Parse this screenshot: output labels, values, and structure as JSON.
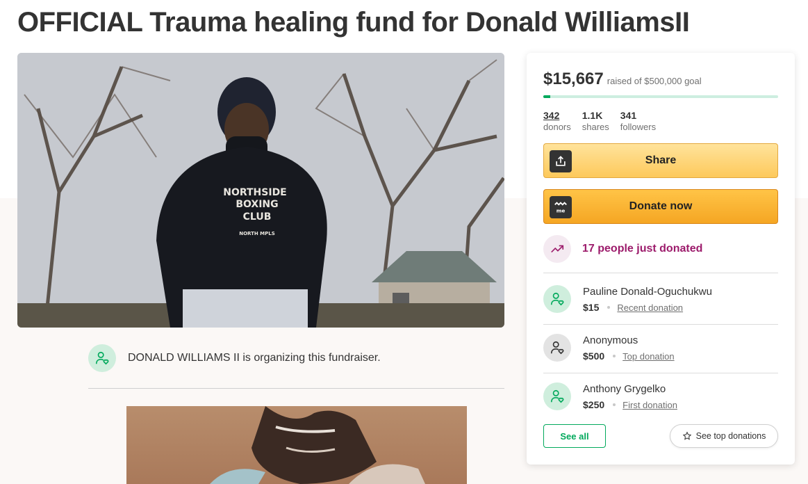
{
  "campaign": {
    "title": "OFFICIAL Trauma healing fund for Donald WilliamsII",
    "organizer_text": "DONALD WILLIAMS II is organizing this fundraiser.",
    "hero_image": "man-in-northside-boxing-club-hoodie-photo",
    "hoodie_text": [
      "NORTHSIDE",
      "BOXING",
      "CLUB",
      "NORTH MPLS"
    ]
  },
  "progress": {
    "raised": "$15,667",
    "goal_text": "raised of $500,000 goal",
    "fraction": 0.031
  },
  "stats": [
    {
      "value": "342",
      "label": "donors"
    },
    {
      "value": "1.1K",
      "label": "shares"
    },
    {
      "value": "341",
      "label": "followers"
    }
  ],
  "buttons": {
    "share": "Share",
    "donate": "Donate now",
    "see_all": "See all",
    "see_top": "See top donations"
  },
  "activity": {
    "recent_text": "17 people just donated"
  },
  "donations": [
    {
      "name": "Pauline Donald-Oguchukwu",
      "amount": "$15",
      "kind": "Recent donation",
      "avatar_color": "#cfeedd"
    },
    {
      "name": "Anonymous",
      "amount": "$500",
      "kind": "Top donation",
      "avatar_color": "#e3e3e3"
    },
    {
      "name": "Anthony Grygelko",
      "amount": "$250",
      "kind": "First donation",
      "avatar_color": "#cfeedd"
    }
  ],
  "colors": {
    "brand_green": "#02a95c",
    "trend_purple": "#9c1b6b",
    "donate_orange": "#f5a623",
    "share_yellow": "#fdc95b"
  }
}
